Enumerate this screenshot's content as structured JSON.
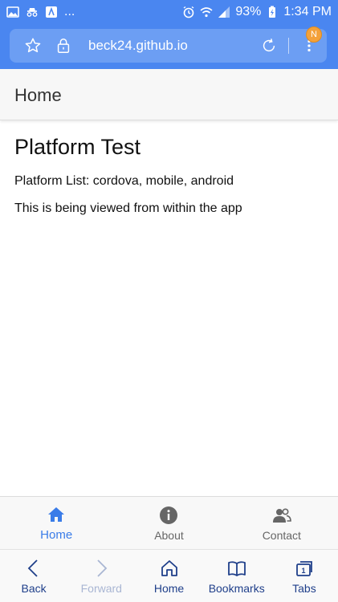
{
  "status_bar": {
    "left_extra": "...",
    "battery": "93%",
    "time": "1:34 PM"
  },
  "browser": {
    "url": "beck24.github.io",
    "badge": "N"
  },
  "header": {
    "title": "Home"
  },
  "content": {
    "heading": "Platform Test",
    "platform_list": "Platform List: cordova, mobile, android",
    "viewed_message": "This is being viewed from within the app"
  },
  "tabs": [
    {
      "label": "Home",
      "icon": "home-icon",
      "active": true
    },
    {
      "label": "About",
      "icon": "info-icon",
      "active": false
    },
    {
      "label": "Contact",
      "icon": "contacts-icon",
      "active": false
    }
  ],
  "bottom_nav": [
    {
      "label": "Back",
      "icon": "back-icon"
    },
    {
      "label": "Forward",
      "icon": "forward-icon"
    },
    {
      "label": "Home",
      "icon": "home-outline-icon"
    },
    {
      "label": "Bookmarks",
      "icon": "bookmarks-icon"
    },
    {
      "label": "Tabs",
      "icon": "tabs-icon"
    }
  ],
  "colors": {
    "chrome": "#4a86f0",
    "accent": "#3a7ce8",
    "nav_text": "#1f3f8a",
    "badge": "#f4a13a"
  }
}
